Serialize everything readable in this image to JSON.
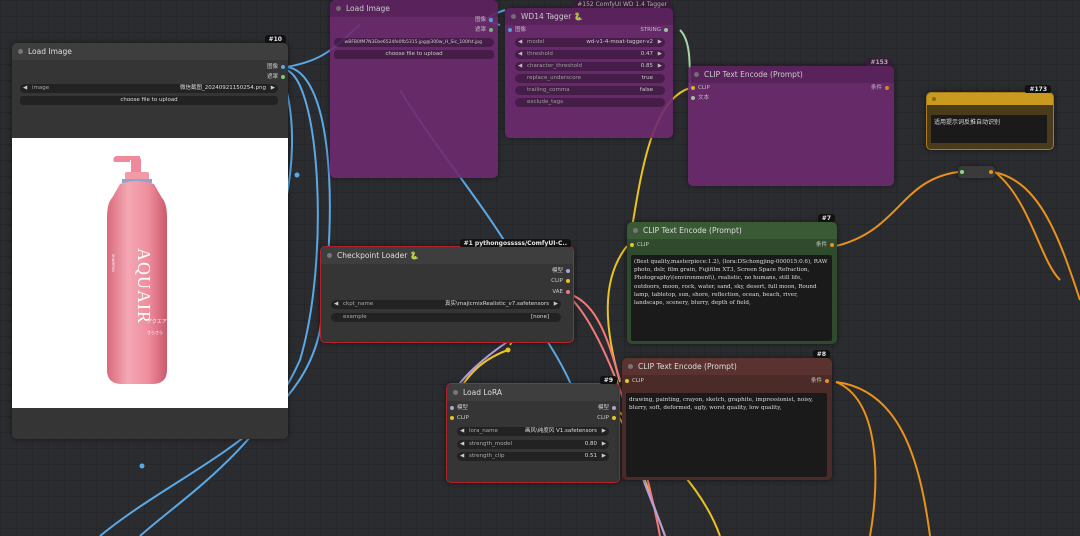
{
  "colors": {
    "purple": "#6e2a70",
    "green": "#2f4a2c",
    "red_border": "#b0232a",
    "brown": "#4a2b28",
    "gold": "#a87c16"
  },
  "bg_load_image": {
    "title": "Load Image",
    "filename": "wBFB0fM7N3Ebe6524fe0fb5315.jpg@300w_H_Sic_100fst.jpg",
    "upload": "choose file to upload",
    "out1": "图像",
    "out2": "遮罩"
  },
  "bg_tagger": {
    "title": "WD14 Tagger 🐍",
    "badge": "#152 ComfyUI WD 1.4 Tagger",
    "input": "图像",
    "output": "STRING",
    "widgets": [
      {
        "label": "model",
        "value": "wd-v1-4-moat-tagger-v2"
      },
      {
        "label": "threshold",
        "value": "0.47"
      },
      {
        "label": "character_threshold",
        "value": "0.85"
      },
      {
        "label": "replace_underscore",
        "value": "true"
      },
      {
        "label": "trailing_comma",
        "value": "false"
      },
      {
        "label": "exclude_tags",
        "value": ""
      }
    ]
  },
  "bg_clip": {
    "title": "CLIP Text Encode (Prompt)",
    "badge": "#153",
    "in1": "CLIP",
    "in2": "文本",
    "out": "条件"
  },
  "note": {
    "badge": "#173",
    "text": "适用提示词反推自动识别"
  },
  "load_image": {
    "badge": "#10",
    "title": "Load Image",
    "out1": "图像",
    "out2": "遮罩",
    "image_label": "image",
    "image_value": "微信截图_20240921150254.png",
    "upload": "choose file to upload",
    "product": {
      "brand": "AQUAIR",
      "jp": "アクエア",
      "sub": "SHAMPOO",
      "small": "さらさら"
    }
  },
  "checkpoint": {
    "badge": "#1 pythongosssss/ComfyUI-C..",
    "title": "Checkpoint Loader 🐍",
    "out1": "模型",
    "out2": "CLIP",
    "out3": "VAE",
    "ckpt_label": "ckpt_name",
    "ckpt_value": "真实\\majicmixRealistic_v7.safetensors",
    "example_label": "example",
    "example_value": "[none]"
  },
  "lora": {
    "badge": "#9",
    "title": "Load LoRA",
    "in1": "模型",
    "in2": "CLIP",
    "out1": "模型",
    "out2": "CLIP",
    "widgets": [
      {
        "label": "lora_name",
        "value": "画风\\纯度风 V1.safetensors"
      },
      {
        "label": "strength_model",
        "value": "0.80"
      },
      {
        "label": "strength_clip",
        "value": "0.51"
      }
    ]
  },
  "clip_pos": {
    "badge": "#7",
    "title": "CLIP Text Encode (Prompt)",
    "in": "CLIP",
    "out": "条件",
    "text": "(Best quality,masterpiece:1.2), (lora:DSchongjing-000015:0.6), RAW photo, dslr, film grain, Fujifilm XT3, Screen Space Refraction, Photography\\(environment\\), realistic, no humans, still life, outdoors, moon, rock, water, sand, sky, desert, full moon, Round lamp, tabletop, sun, shore, reflection, ocean, beach, river, landscape, scenery, blurry, depth of field,"
  },
  "clip_neg": {
    "badge": "#8",
    "title": "CLIP Text Encode (Prompt)",
    "in": "CLIP",
    "out": "条件",
    "text": "drawing, painting, crayon, sketch, graphite, impressionist, noisy, blurry, soft, deformed, ugly, worst quality, low quality,"
  }
}
